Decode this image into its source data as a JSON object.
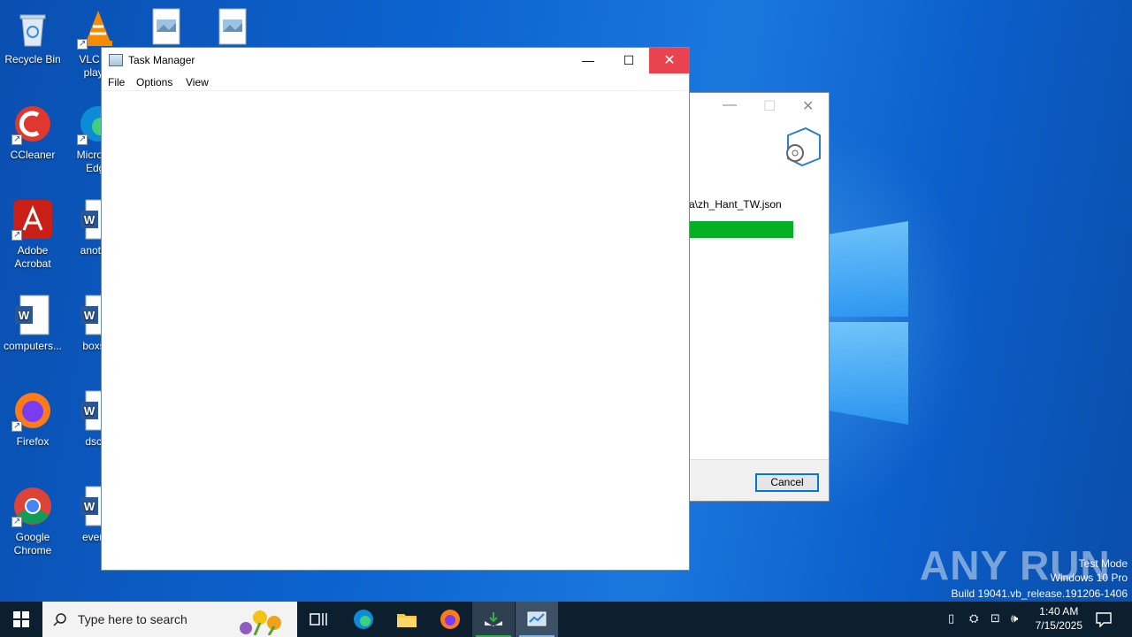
{
  "desktop": {
    "icons": [
      {
        "label": "Recycle Bin"
      },
      {
        "label": "VLC me player"
      },
      {
        "label": "CCleaner"
      },
      {
        "label": "Microsoft Edge"
      },
      {
        "label": "Adobe Acrobat"
      },
      {
        "label": "another"
      },
      {
        "label": "computers..."
      },
      {
        "label": "boxstu"
      },
      {
        "label": "Firefox"
      },
      {
        "label": "dscre"
      },
      {
        "label": "Google Chrome"
      },
      {
        "label": "everyo"
      }
    ]
  },
  "task_manager": {
    "title": "Task Manager",
    "menu": [
      "File",
      "Options",
      "View"
    ],
    "controls": {
      "minimize": "—",
      "maximize": "☐",
      "close": "✕"
    }
  },
  "installer": {
    "path_text": "a\\zh_Hant_TW.json",
    "progress_fraction": 1.0,
    "progress_color": "#06b025",
    "cancel_label": "Cancel"
  },
  "watermark": {
    "brand": "ANY RUN",
    "line1": "Test Mode",
    "line2": "Windows 10 Pro",
    "line3": "Build 19041.vb_release.191206-1406"
  },
  "taskbar": {
    "search_placeholder": "Type here to search",
    "time": "1:40 AM",
    "date": "7/15/2025"
  }
}
